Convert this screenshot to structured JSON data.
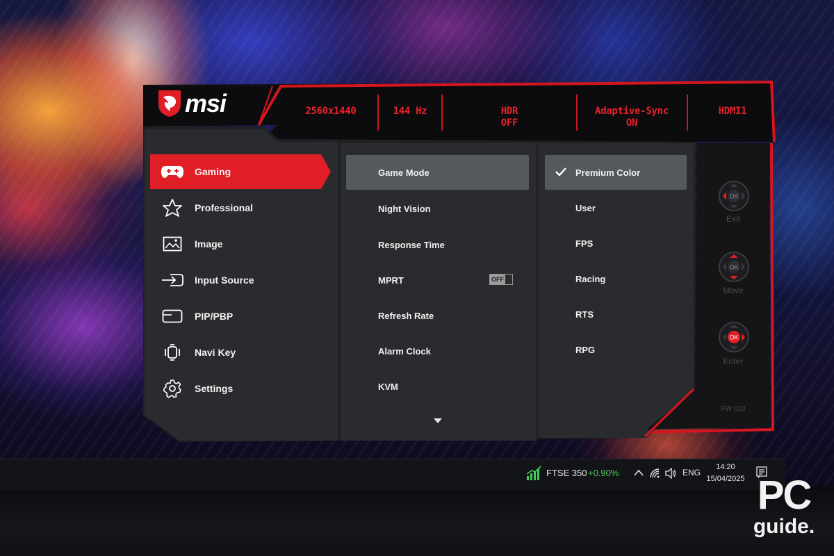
{
  "colors": {
    "accent": "#e8212a",
    "panel": "#2b2c2f",
    "highlight": "#55585c"
  },
  "brand": {
    "name": "msi"
  },
  "header": {
    "resolution": "2560x1440",
    "refresh": "144 Hz",
    "hdr_line1": "HDR",
    "hdr_line2": "OFF",
    "sync_line1": "Adaptive-Sync",
    "sync_line2": "ON",
    "input": "HDMI1"
  },
  "menu": [
    {
      "label": "Gaming",
      "icon": "gamepad-icon",
      "active": true
    },
    {
      "label": "Professional",
      "icon": "star-icon"
    },
    {
      "label": "Image",
      "icon": "image-icon"
    },
    {
      "label": "Input Source",
      "icon": "input-source-icon"
    },
    {
      "label": "PIP/PBP",
      "icon": "pip-icon"
    },
    {
      "label": "Navi Key",
      "icon": "navi-key-icon"
    },
    {
      "label": "Settings",
      "icon": "gear-icon"
    }
  ],
  "submenu": [
    {
      "label": "Game Mode",
      "active": true
    },
    {
      "label": "Night Vision"
    },
    {
      "label": "Response Time"
    },
    {
      "label": "MPRT",
      "toggle": "OFF"
    },
    {
      "label": "Refresh Rate"
    },
    {
      "label": "Alarm Clock"
    },
    {
      "label": "KVM"
    }
  ],
  "options": [
    {
      "label": "Premium Color",
      "selected": true
    },
    {
      "label": "User"
    },
    {
      "label": "FPS"
    },
    {
      "label": "Racing"
    },
    {
      "label": "RTS"
    },
    {
      "label": "RPG"
    }
  ],
  "keys": [
    {
      "label": "Exit",
      "center": "OK"
    },
    {
      "label": "Move",
      "center": "OK"
    },
    {
      "label": "Enter",
      "center": "OK"
    }
  ],
  "firmware": "FW 010",
  "taskbar": {
    "ticker": "FTSE 350",
    "change": "+0.90%",
    "language": "ENG",
    "time": "14:20",
    "date": "15/04/2025"
  },
  "watermark": {
    "line1": "PC",
    "line2": "guide."
  }
}
